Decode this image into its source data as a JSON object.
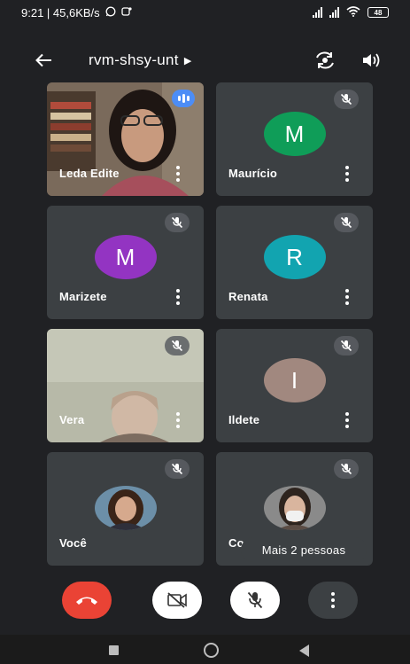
{
  "status_bar": {
    "time_speed": "9:21 | 45,6KB/s",
    "battery": "48"
  },
  "top_bar": {
    "room_code": "rvm-shsy-unt"
  },
  "participants": [
    {
      "name": "Leda Edite"
    },
    {
      "name": "Maurício",
      "initial": "M",
      "avatar_color": "#0f9d58"
    },
    {
      "name": "Marizete",
      "initial": "M",
      "avatar_color": "#9334c2"
    },
    {
      "name": "Renata",
      "initial": "R",
      "avatar_color": "#12a4b0"
    },
    {
      "name": "Vera"
    },
    {
      "name": "Ildete",
      "initial": "I",
      "avatar_color": "#a1887f"
    },
    {
      "name": "Você"
    },
    {
      "name": "Co"
    }
  ],
  "more_people": "Mais 2 pessoas",
  "colors": {
    "background": "#202124",
    "tile": "#3c4043",
    "hangup": "#ea4335",
    "speaking": "#4c8df6"
  }
}
